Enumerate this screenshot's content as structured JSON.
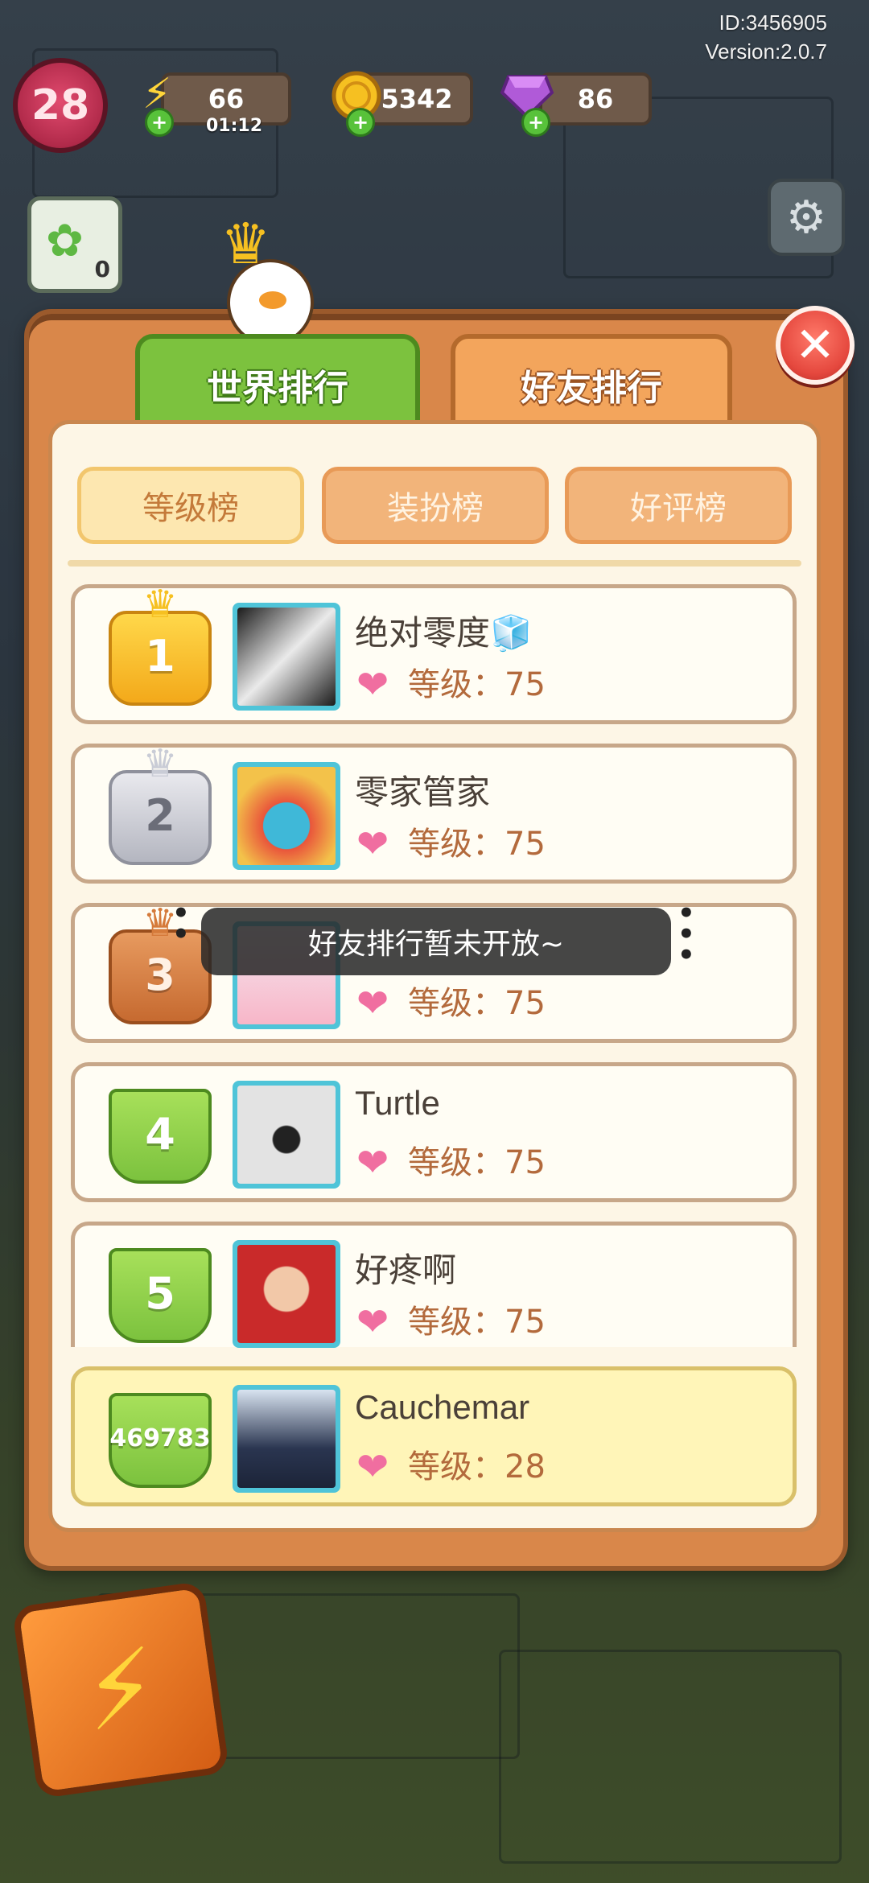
{
  "hud": {
    "id_text": "ID:3456905",
    "version_text": "Version:2.0.7",
    "player_level": "28",
    "energy": "66",
    "energy_timer": "01:12",
    "coins": "5342",
    "gems": "86",
    "quest_count": "0"
  },
  "tabs": {
    "world": "世界排行",
    "friends": "好友排行"
  },
  "subtabs": [
    "等级榜",
    "装扮榜",
    "好评榜"
  ],
  "leaderboard": [
    {
      "rank": "1",
      "name": "绝对零度🧊",
      "level_label": "等级：",
      "level": "75"
    },
    {
      "rank": "2",
      "name": "零家管家",
      "level_label": "等级：",
      "level": "75"
    },
    {
      "rank": "3",
      "name": "",
      "level_label": "等级：",
      "level": "75"
    },
    {
      "rank": "4",
      "name": "Turtle",
      "level_label": "等级：",
      "level": "75"
    },
    {
      "rank": "5",
      "name": "好疼啊",
      "level_label": "等级：",
      "level": "75"
    }
  ],
  "my_entry": {
    "rank": "469783",
    "name": "Cauchemar",
    "level_label": "等级：",
    "level": "28"
  },
  "toast": "好友排行暂未开放~",
  "icons": {
    "close": "close-icon",
    "settings": "gear-icon",
    "energy": "lightning-icon",
    "coin": "coin-icon",
    "gem": "gem-icon",
    "heart": "heart-icon"
  },
  "colors": {
    "world_tab": "#7cc23e",
    "friend_tab": "#f3a55c",
    "panel": "#d9874a",
    "close": "#e5483e"
  }
}
